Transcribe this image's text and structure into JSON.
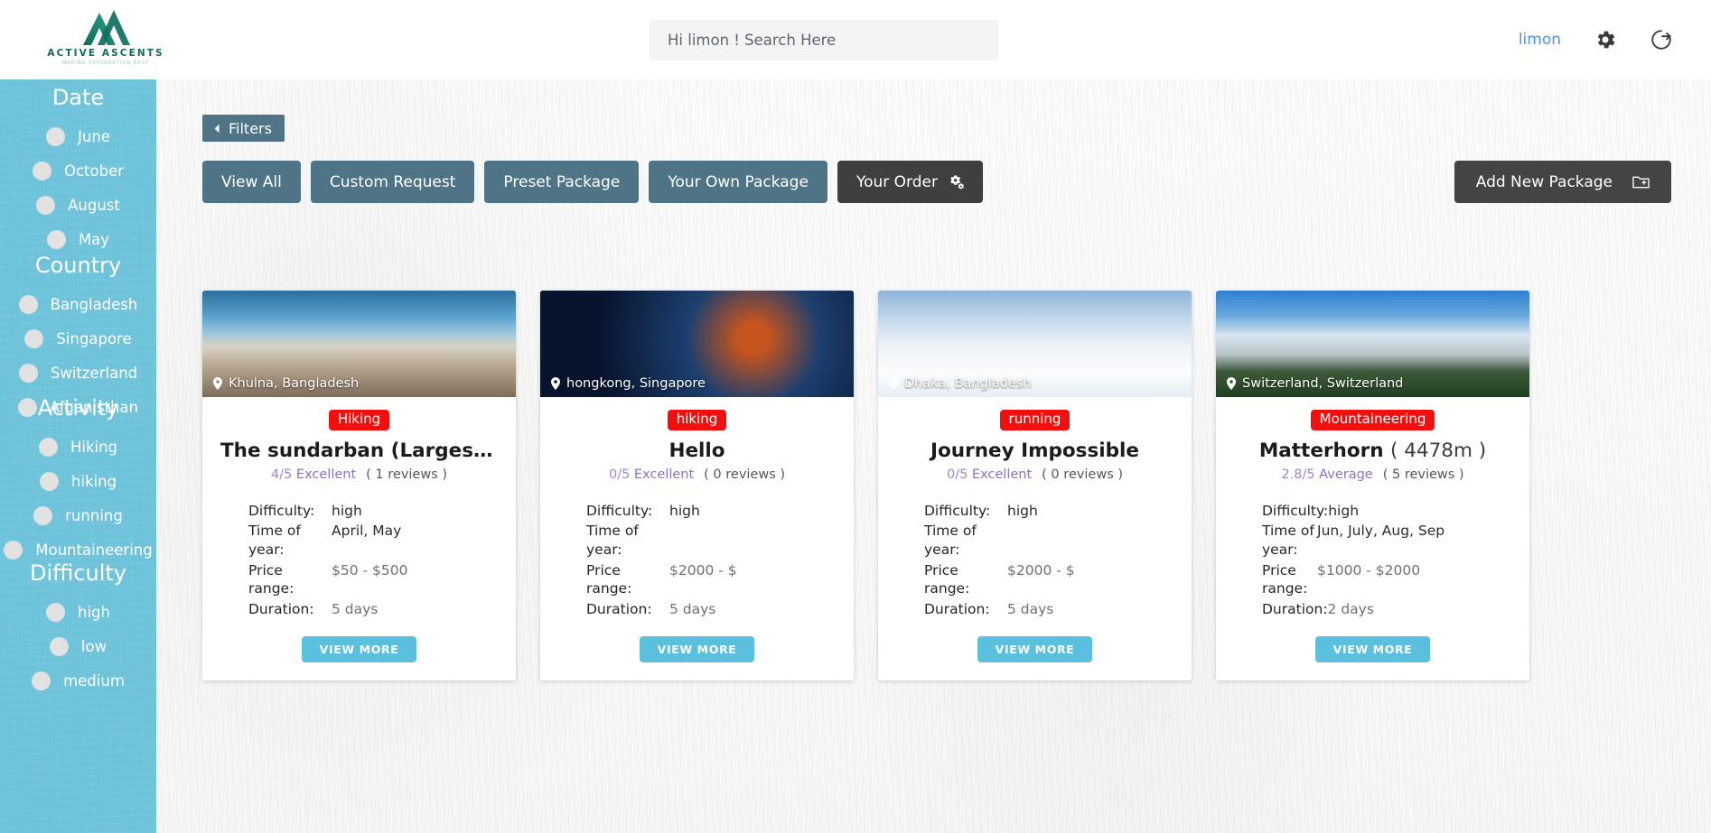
{
  "brand": {
    "name": "ACTIVE ASCENTS",
    "tagline": "MAKING EXPLORATION EASY",
    "color": "#0f6b5c"
  },
  "header": {
    "search_placeholder": "Hi limon ! Search Here",
    "search_value": "",
    "user": "limon",
    "user_color": "#4f8ef7",
    "settings_icon": "gear-icon",
    "logout_icon": "logout-icon"
  },
  "sidebar": {
    "background": "#6ec3da",
    "groups": [
      {
        "title": "Date",
        "items": [
          {
            "label": "June"
          },
          {
            "label": "October"
          },
          {
            "label": "August"
          },
          {
            "label": "May"
          }
        ]
      },
      {
        "title": "Country",
        "items": [
          {
            "label": "Bangladesh"
          },
          {
            "label": "Singapore"
          },
          {
            "label": "Switzerland"
          },
          {
            "label": "Afganisthan"
          }
        ]
      },
      {
        "title": "Activity",
        "items": [
          {
            "label": "Hiking"
          },
          {
            "label": "hiking"
          },
          {
            "label": "running"
          },
          {
            "label": "Mountaineering"
          }
        ]
      },
      {
        "title": "Difficulty",
        "items": [
          {
            "label": "high"
          },
          {
            "label": "low"
          },
          {
            "label": "medium"
          }
        ]
      }
    ]
  },
  "toolbar": {
    "filters_label": "Filters",
    "tabs": [
      {
        "label": "View All",
        "active": false
      },
      {
        "label": "Custom Request",
        "active": false
      },
      {
        "label": "Preset Package",
        "active": false
      },
      {
        "label": "Your Own Package",
        "active": false
      },
      {
        "label": "Your Order",
        "active": true,
        "icon": "gears-icon"
      }
    ],
    "add_package_label": "Add New Package",
    "add_package_icon": "folder-plus-icon",
    "tab_color": "#4e7486",
    "active_tab_color": "#3f3f3f"
  },
  "spec_labels": {
    "difficulty": "Difficulty:",
    "time_of_year": "Time of year:",
    "price_range": "Price range:",
    "duration": "Duration:"
  },
  "view_more_label": "VIEW MORE",
  "cards": [
    {
      "location": "Khulna, Bangladesh",
      "tag": "Hiking",
      "title": "The sundarban (Largest Mangr...",
      "rating_score": "4/5",
      "rating_word": "Excellent",
      "reviews": "( 1 reviews )",
      "difficulty": "high",
      "time_of_year": "April, May",
      "price_range": "$50 - $500",
      "duration": "5 days"
    },
    {
      "location": "hongkong, Singapore",
      "tag": "hiking",
      "title": "Hello",
      "rating_score": "0/5",
      "rating_word": "Excellent",
      "reviews": "( 0 reviews )",
      "difficulty": "high",
      "time_of_year": "",
      "price_range": "$2000 - $",
      "duration": "5 days"
    },
    {
      "location": "Dhaka, Bangladesh",
      "tag": "running",
      "title": "Journey Impossible",
      "rating_score": "0/5",
      "rating_word": "Excellent",
      "reviews": "( 0 reviews )",
      "difficulty": "high",
      "time_of_year": "",
      "price_range": "$2000 - $",
      "duration": "5 days"
    },
    {
      "location": "Switzerland, Switzerland",
      "tag": "Mountaineering",
      "title": "Matterhorn",
      "title_suffix": "( 4478m )",
      "rating_score": "2.8/5",
      "rating_word": "Average",
      "reviews": "( 5 reviews )",
      "difficulty": "high",
      "time_of_year": "Jun, July, Aug, Sep",
      "price_range": "$1000 - $2000",
      "duration": "2 days"
    }
  ]
}
